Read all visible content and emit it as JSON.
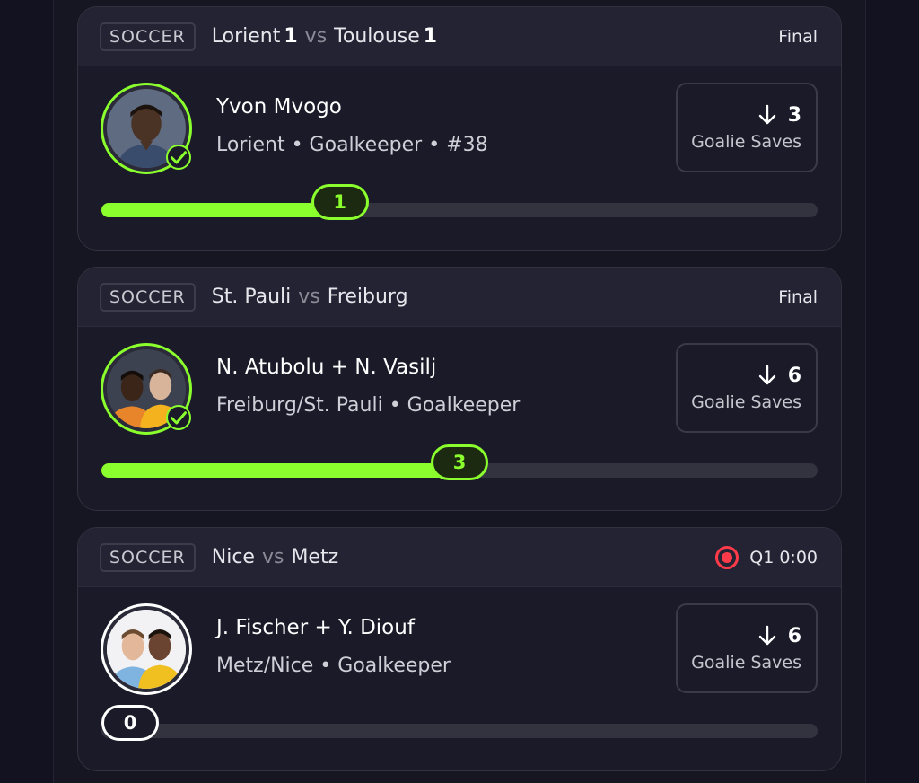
{
  "cards": [
    {
      "sport": "SOCCER",
      "home_team": "Lorient",
      "home_score": "1",
      "vs": "vs",
      "away_team": "Toulouse",
      "away_score": "1",
      "status": "Final",
      "player_name": "Yvon Mvogo",
      "player_info": "Lorient • Goalkeeper • #38",
      "stat_value": "3",
      "stat_label": "Goalie Saves",
      "progress_value": "1",
      "progress_fraction": 0.333,
      "avatar_verified": true
    },
    {
      "sport": "SOCCER",
      "home_team": "St. Pauli",
      "vs": "vs",
      "away_team": "Freiburg",
      "status": "Final",
      "player_name": "N. Atubolu + N. Vasilj",
      "player_info": "Freiburg/St. Pauli • Goalkeeper",
      "stat_value": "6",
      "stat_label": "Goalie Saves",
      "progress_value": "3",
      "progress_fraction": 0.5,
      "avatar_verified": true
    },
    {
      "sport": "SOCCER",
      "home_team": "Nice",
      "vs": "vs",
      "away_team": "Metz",
      "status": "Q1 0:00",
      "live": true,
      "player_name": "J. Fischer + Y. Diouf",
      "player_info": "Metz/Nice • Goalkeeper",
      "stat_value": "6",
      "stat_label": "Goalie Saves",
      "progress_value": "0",
      "progress_fraction": 0,
      "avatar_verified": false
    }
  ],
  "icons": {
    "stat_direction": "arrow-down-icon",
    "verified": "check-circle-icon",
    "live": "live-record-icon"
  },
  "colors": {
    "accent": "#8aff2d",
    "live": "#ff3b4a",
    "background": "#141420",
    "card": "#1a1a28",
    "card_header": "#232333"
  }
}
